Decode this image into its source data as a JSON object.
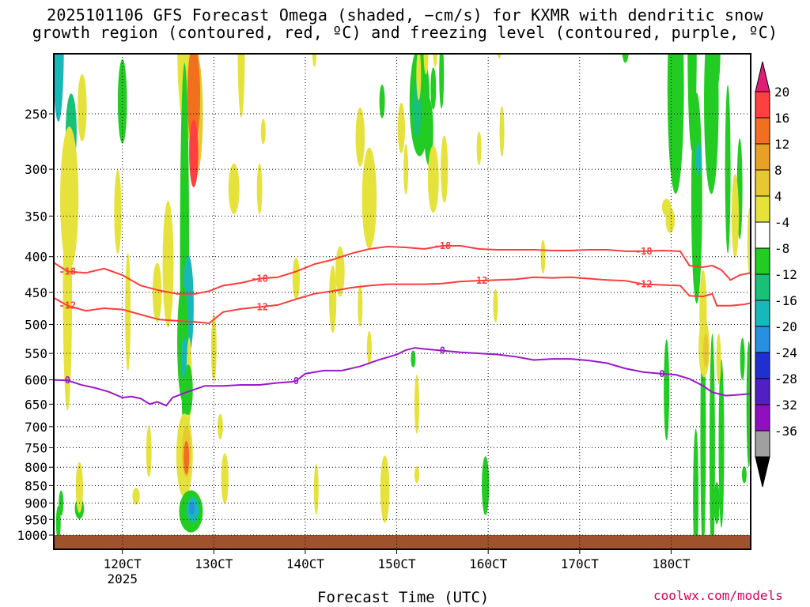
{
  "title_lines": [
    "2025101106 GFS Forecast Omega (shaded, −cm/s) for KXMR with dendritic snow",
    "growth region (contoured, red, ºC) and freezing level (contoured, purple, ºC)"
  ],
  "footer": {
    "xlabel": "Forecast Time (UTC)",
    "credit": "coolwx.com/models"
  },
  "chart_data": {
    "type": "heatmap",
    "title": "2025101106 GFS Forecast Omega (shaded, −cm/s) for KXMR with dendritic snow growth region (contoured, red, ºC) and freezing level (contoured, purple, ºC)",
    "xlabel": "Forecast Time (UTC)",
    "ylabel": "",
    "x_ticks": [
      {
        "label": "120CT",
        "sub": "2025"
      },
      {
        "label": "130CT",
        "sub": ""
      },
      {
        "label": "140CT",
        "sub": ""
      },
      {
        "label": "150CT",
        "sub": ""
      },
      {
        "label": "160CT",
        "sub": ""
      },
      {
        "label": "170CT",
        "sub": ""
      },
      {
        "label": "180CT",
        "sub": ""
      }
    ],
    "xlim_days": [
      11.25,
      18.87
    ],
    "y_ticks": [
      250,
      300,
      350,
      400,
      450,
      500,
      550,
      600,
      650,
      700,
      750,
      800,
      850,
      900,
      950,
      1000
    ],
    "y_scale": "log",
    "ylim_hPa": [
      1020,
      200
    ],
    "grid": "dotted",
    "colorbar": {
      "ticks": [
        "20",
        "16",
        "12",
        "8",
        "4",
        "-4",
        "-8",
        "-12",
        "-16",
        "-20",
        "-24",
        "-28",
        "-32",
        "-36"
      ],
      "colors": [
        "#ff3f40",
        "#f07020",
        "#e8a028",
        "#e6c832",
        "#e6e23c",
        "#ffffff",
        "#22cc22",
        "#18c078",
        "#18b8b8",
        "#2890e0",
        "#2030d0",
        "#5020c0",
        "#9010c0",
        "#a0a0a0"
      ],
      "top_arrow_color": "#e01e78",
      "bottom_arrow_color": "#000000"
    },
    "dgz_minus18": {
      "color": "#ff3c3c",
      "label": "-18",
      "points": [
        [
          11.25,
          408
        ],
        [
          11.4,
          420
        ],
        [
          11.6,
          422
        ],
        [
          11.8,
          416
        ],
        [
          12.0,
          425
        ],
        [
          12.2,
          440
        ],
        [
          12.4,
          447
        ],
        [
          12.6,
          452
        ],
        [
          12.8,
          452
        ],
        [
          12.95,
          448
        ],
        [
          13.1,
          440
        ],
        [
          13.3,
          436
        ],
        [
          13.5,
          430
        ],
        [
          13.7,
          428
        ],
        [
          13.9,
          420
        ],
        [
          14.1,
          410
        ],
        [
          14.3,
          404
        ],
        [
          14.5,
          396
        ],
        [
          14.7,
          390
        ],
        [
          14.9,
          387
        ],
        [
          15.1,
          388
        ],
        [
          15.3,
          390
        ],
        [
          15.5,
          386
        ],
        [
          15.7,
          386
        ],
        [
          15.9,
          390
        ],
        [
          16.1,
          391
        ],
        [
          16.3,
          391
        ],
        [
          16.5,
          391
        ],
        [
          16.7,
          392
        ],
        [
          16.9,
          392
        ],
        [
          17.1,
          391
        ],
        [
          17.3,
          391
        ],
        [
          17.5,
          393
        ],
        [
          17.7,
          393
        ],
        [
          17.9,
          392
        ],
        [
          18.1,
          393
        ],
        [
          18.2,
          412
        ],
        [
          18.35,
          414
        ],
        [
          18.45,
          412
        ],
        [
          18.55,
          418
        ],
        [
          18.65,
          432
        ],
        [
          18.75,
          425
        ],
        [
          18.87,
          422
        ]
      ]
    },
    "dgz_minus12": {
      "color": "#ff3c3c",
      "label": "-12",
      "points": [
        [
          11.25,
          458
        ],
        [
          11.4,
          470
        ],
        [
          11.6,
          478
        ],
        [
          11.8,
          474
        ],
        [
          12.0,
          476
        ],
        [
          12.2,
          484
        ],
        [
          12.4,
          492
        ],
        [
          12.6,
          494
        ],
        [
          12.8,
          496
        ],
        [
          12.95,
          498
        ],
        [
          13.1,
          480
        ],
        [
          13.3,
          475
        ],
        [
          13.5,
          472
        ],
        [
          13.7,
          469
        ],
        [
          13.9,
          460
        ],
        [
          14.1,
          452
        ],
        [
          14.3,
          448
        ],
        [
          14.5,
          443
        ],
        [
          14.7,
          440
        ],
        [
          14.9,
          438
        ],
        [
          15.1,
          438
        ],
        [
          15.3,
          438
        ],
        [
          15.5,
          437
        ],
        [
          15.7,
          434
        ],
        [
          15.9,
          433
        ],
        [
          16.1,
          432
        ],
        [
          16.3,
          431
        ],
        [
          16.5,
          428
        ],
        [
          16.7,
          429
        ],
        [
          16.9,
          428
        ],
        [
          17.1,
          430
        ],
        [
          17.3,
          432
        ],
        [
          17.5,
          433
        ],
        [
          17.7,
          438
        ],
        [
          17.9,
          439
        ],
        [
          18.1,
          440
        ],
        [
          18.2,
          455
        ],
        [
          18.35,
          456
        ],
        [
          18.45,
          452
        ],
        [
          18.5,
          470
        ],
        [
          18.65,
          470
        ],
        [
          18.8,
          468
        ],
        [
          18.87,
          466
        ]
      ]
    },
    "freezing_level": {
      "color": "#9a18cc",
      "label": "0",
      "points": [
        [
          11.25,
          600
        ],
        [
          11.4,
          601
        ],
        [
          11.55,
          610
        ],
        [
          11.7,
          616
        ],
        [
          11.85,
          624
        ],
        [
          12.0,
          636
        ],
        [
          12.1,
          634
        ],
        [
          12.2,
          638
        ],
        [
          12.3,
          650
        ],
        [
          12.38,
          645
        ],
        [
          12.48,
          653
        ],
        [
          12.55,
          636
        ],
        [
          12.7,
          625
        ],
        [
          12.9,
          612
        ],
        [
          13.1,
          612
        ],
        [
          13.3,
          610
        ],
        [
          13.5,
          610
        ],
        [
          13.7,
          606
        ],
        [
          13.85,
          604
        ],
        [
          13.9,
          602
        ],
        [
          14.0,
          588
        ],
        [
          14.2,
          582
        ],
        [
          14.4,
          582
        ],
        [
          14.6,
          574
        ],
        [
          14.8,
          562
        ],
        [
          15.0,
          552
        ],
        [
          15.1,
          544
        ],
        [
          15.2,
          540
        ],
        [
          15.3,
          542
        ],
        [
          15.5,
          545
        ],
        [
          15.7,
          548
        ],
        [
          15.9,
          550
        ],
        [
          16.1,
          552
        ],
        [
          16.3,
          556
        ],
        [
          16.5,
          562
        ],
        [
          16.7,
          560
        ],
        [
          16.9,
          560
        ],
        [
          17.1,
          563
        ],
        [
          17.3,
          568
        ],
        [
          17.5,
          578
        ],
        [
          17.7,
          585
        ],
        [
          17.9,
          588
        ],
        [
          18.05,
          590
        ],
        [
          18.2,
          598
        ],
        [
          18.35,
          612
        ],
        [
          18.45,
          625
        ],
        [
          18.6,
          632
        ],
        [
          18.75,
          630
        ],
        [
          18.87,
          628
        ]
      ]
    },
    "omega_blobs": [
      [
        11.44,
        265,
        0.06,
        0.09,
        3
      ],
      [
        11.3,
        200,
        0.06,
        0.18,
        4
      ],
      [
        11.42,
        330,
        0.1,
        0.17,
        0
      ],
      [
        11.4,
        450,
        0.05,
        0.28,
        0
      ],
      [
        11.33,
        900,
        0.02,
        0.03,
        2
      ],
      [
        11.3,
        960,
        0.01,
        0.04,
        2
      ],
      [
        11.53,
        916,
        0.05,
        0.025,
        2
      ],
      [
        11.53,
        855,
        0.04,
        0.06,
        0
      ],
      [
        11.56,
        245,
        0.05,
        0.08,
        0
      ],
      [
        12.0,
        240,
        0.05,
        0.1,
        2
      ],
      [
        11.95,
        345,
        0.04,
        0.1,
        0
      ],
      [
        12.06,
        480,
        0.03,
        0.14,
        0
      ],
      [
        12.38,
        450,
        0.05,
        0.07,
        0
      ],
      [
        12.5,
        410,
        0.06,
        0.15,
        0
      ],
      [
        12.15,
        880,
        0.04,
        0.02,
        0
      ],
      [
        12.29,
        760,
        0.03,
        0.06,
        0
      ],
      [
        12.72,
        200,
        0.12,
        0.22,
        0
      ],
      [
        12.8,
        250,
        0.08,
        0.15,
        8
      ],
      [
        12.78,
        235,
        0.07,
        0.12,
        12
      ],
      [
        12.78,
        285,
        0.05,
        0.08,
        16
      ],
      [
        12.68,
        395,
        0.05,
        0.45,
        2
      ],
      [
        12.72,
        470,
        0.06,
        0.12,
        4
      ],
      [
        12.66,
        530,
        0.06,
        0.14,
        2
      ],
      [
        12.68,
        560,
        0.04,
        0.05,
        4
      ],
      [
        12.73,
        600,
        0.03,
        0.1,
        0
      ],
      [
        12.72,
        620,
        0.05,
        0.06,
        2
      ],
      [
        12.68,
        770,
        0.09,
        0.1,
        0
      ],
      [
        12.7,
        760,
        0.05,
        0.06,
        8
      ],
      [
        12.7,
        775,
        0.03,
        0.04,
        12
      ],
      [
        12.75,
        925,
        0.13,
        0.05,
        2
      ],
      [
        12.77,
        920,
        0.07,
        0.03,
        4
      ],
      [
        12.76,
        915,
        0.03,
        0.015,
        5
      ],
      [
        13.0,
        540,
        0.03,
        0.08,
        0
      ],
      [
        13.3,
        200,
        0.04,
        0.17,
        0
      ],
      [
        13.22,
        320,
        0.06,
        0.06,
        0
      ],
      [
        13.12,
        830,
        0.04,
        0.06,
        0
      ],
      [
        13.07,
        700,
        0.03,
        0.03,
        0
      ],
      [
        13.5,
        320,
        0.03,
        0.06,
        0
      ],
      [
        13.54,
        265,
        0.02,
        0.03,
        0
      ],
      [
        13.9,
        430,
        0.04,
        0.05,
        0
      ],
      [
        14.38,
        420,
        0.05,
        0.06,
        0
      ],
      [
        14.1,
        200,
        0.02,
        0.05,
        0
      ],
      [
        14.3,
        460,
        0.04,
        0.08,
        0
      ],
      [
        14.12,
        860,
        0.02,
        0.06,
        0
      ],
      [
        14.6,
        270,
        0.05,
        0.07,
        0
      ],
      [
        14.7,
        330,
        0.08,
        0.12,
        0
      ],
      [
        14.6,
        470,
        0.02,
        0.05,
        0
      ],
      [
        14.7,
        540,
        0.02,
        0.04,
        0
      ],
      [
        14.84,
        240,
        0.03,
        0.04,
        2
      ],
      [
        14.87,
        860,
        0.05,
        0.08,
        0
      ],
      [
        14.85,
        140,
        0.02,
        0.07,
        0
      ],
      [
        15.05,
        262,
        0.04,
        0.06,
        0
      ],
      [
        15.1,
        300,
        0.02,
        0.06,
        0
      ],
      [
        15.25,
        240,
        0.11,
        0.13,
        2
      ],
      [
        15.22,
        245,
        0.05,
        0.07,
        3
      ],
      [
        15.35,
        265,
        0.05,
        0.08,
        2
      ],
      [
        15.4,
        230,
        0.03,
        0.05,
        2
      ],
      [
        15.4,
        310,
        0.06,
        0.08,
        0
      ],
      [
        15.24,
        220,
        0.02,
        0.06,
        0
      ],
      [
        15.32,
        205,
        0.02,
        0.05,
        0
      ],
      [
        15.42,
        200,
        0.02,
        0.05,
        0
      ],
      [
        15.49,
        220,
        0.02,
        0.08,
        2
      ],
      [
        15.52,
        300,
        0.04,
        0.08,
        0
      ],
      [
        15.18,
        560,
        0.02,
        0.02,
        2
      ],
      [
        15.22,
        650,
        0.02,
        0.07,
        0
      ],
      [
        15.22,
        820,
        0.01,
        0.02,
        0
      ],
      [
        15.9,
        280,
        0.02,
        0.04,
        0
      ],
      [
        15.97,
        850,
        0.04,
        0.07,
        2
      ],
      [
        16.12,
        200,
        0.02,
        0.03,
        0
      ],
      [
        16.15,
        265,
        0.02,
        0.06,
        0
      ],
      [
        16.08,
        470,
        0.02,
        0.04,
        0
      ],
      [
        16.6,
        400,
        0.02,
        0.04,
        0
      ],
      [
        17.95,
        340,
        0.05,
        0.02,
        0
      ],
      [
        17.99,
        355,
        0.05,
        0.03,
        0
      ],
      [
        17.5,
        200,
        0.04,
        0.04,
        2
      ],
      [
        17.95,
        620,
        0.03,
        0.12,
        2
      ],
      [
        18.05,
        230,
        0.09,
        0.25,
        2
      ],
      [
        18.23,
        200,
        0.05,
        0.25,
        2
      ],
      [
        18.28,
        330,
        0.06,
        0.25,
        2
      ],
      [
        18.3,
        290,
        0.03,
        0.04,
        4
      ],
      [
        18.44,
        240,
        0.08,
        0.22,
        2
      ],
      [
        18.5,
        200,
        0.04,
        0.1,
        2
      ],
      [
        18.62,
        300,
        0.03,
        0.2,
        2
      ],
      [
        18.75,
        320,
        0.03,
        0.12,
        2
      ],
      [
        18.55,
        740,
        0.03,
        0.2,
        2
      ],
      [
        18.5,
        900,
        0.03,
        0.05,
        2
      ],
      [
        18.45,
        760,
        0.03,
        0.28,
        2
      ],
      [
        18.35,
        720,
        0.03,
        0.28,
        2
      ],
      [
        18.27,
        880,
        0.03,
        0.16,
        2
      ],
      [
        18.35,
        480,
        0.04,
        0.1,
        0
      ],
      [
        18.36,
        540,
        0.06,
        0.07,
        0
      ],
      [
        18.38,
        545,
        0.03,
        0.04,
        8
      ],
      [
        18.52,
        560,
        0.02,
        0.06,
        0
      ],
      [
        18.7,
        350,
        0.04,
        0.1,
        0
      ],
      [
        18.86,
        380,
        0.02,
        0.08,
        0
      ],
      [
        18.78,
        560,
        0.02,
        0.05,
        2
      ],
      [
        18.8,
        820,
        0.02,
        0.02,
        2
      ],
      [
        18.85,
        650,
        0.02,
        0.15,
        2
      ]
    ]
  }
}
